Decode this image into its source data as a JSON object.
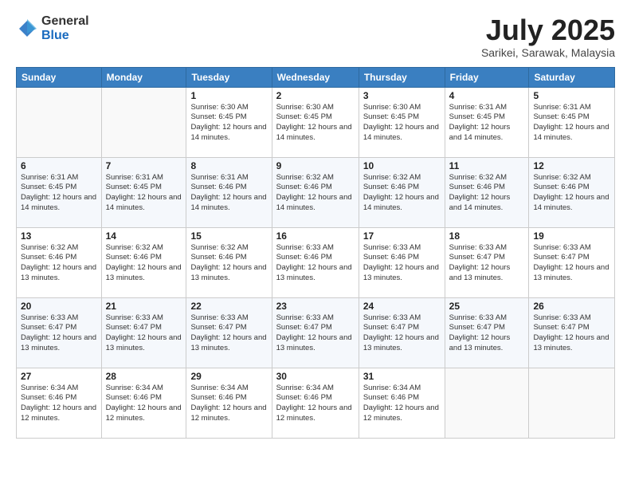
{
  "header": {
    "logo_general": "General",
    "logo_blue": "Blue",
    "month_title": "July 2025",
    "subtitle": "Sarikei, Sarawak, Malaysia"
  },
  "days_of_week": [
    "Sunday",
    "Monday",
    "Tuesday",
    "Wednesday",
    "Thursday",
    "Friday",
    "Saturday"
  ],
  "weeks": [
    [
      {
        "day": "",
        "info": ""
      },
      {
        "day": "",
        "info": ""
      },
      {
        "day": "1",
        "info": "Sunrise: 6:30 AM\nSunset: 6:45 PM\nDaylight: 12 hours and 14 minutes."
      },
      {
        "day": "2",
        "info": "Sunrise: 6:30 AM\nSunset: 6:45 PM\nDaylight: 12 hours and 14 minutes."
      },
      {
        "day": "3",
        "info": "Sunrise: 6:30 AM\nSunset: 6:45 PM\nDaylight: 12 hours and 14 minutes."
      },
      {
        "day": "4",
        "info": "Sunrise: 6:31 AM\nSunset: 6:45 PM\nDaylight: 12 hours and 14 minutes."
      },
      {
        "day": "5",
        "info": "Sunrise: 6:31 AM\nSunset: 6:45 PM\nDaylight: 12 hours and 14 minutes."
      }
    ],
    [
      {
        "day": "6",
        "info": "Sunrise: 6:31 AM\nSunset: 6:45 PM\nDaylight: 12 hours and 14 minutes."
      },
      {
        "day": "7",
        "info": "Sunrise: 6:31 AM\nSunset: 6:45 PM\nDaylight: 12 hours and 14 minutes."
      },
      {
        "day": "8",
        "info": "Sunrise: 6:31 AM\nSunset: 6:46 PM\nDaylight: 12 hours and 14 minutes."
      },
      {
        "day": "9",
        "info": "Sunrise: 6:32 AM\nSunset: 6:46 PM\nDaylight: 12 hours and 14 minutes."
      },
      {
        "day": "10",
        "info": "Sunrise: 6:32 AM\nSunset: 6:46 PM\nDaylight: 12 hours and 14 minutes."
      },
      {
        "day": "11",
        "info": "Sunrise: 6:32 AM\nSunset: 6:46 PM\nDaylight: 12 hours and 14 minutes."
      },
      {
        "day": "12",
        "info": "Sunrise: 6:32 AM\nSunset: 6:46 PM\nDaylight: 12 hours and 14 minutes."
      }
    ],
    [
      {
        "day": "13",
        "info": "Sunrise: 6:32 AM\nSunset: 6:46 PM\nDaylight: 12 hours and 13 minutes."
      },
      {
        "day": "14",
        "info": "Sunrise: 6:32 AM\nSunset: 6:46 PM\nDaylight: 12 hours and 13 minutes."
      },
      {
        "day": "15",
        "info": "Sunrise: 6:32 AM\nSunset: 6:46 PM\nDaylight: 12 hours and 13 minutes."
      },
      {
        "day": "16",
        "info": "Sunrise: 6:33 AM\nSunset: 6:46 PM\nDaylight: 12 hours and 13 minutes."
      },
      {
        "day": "17",
        "info": "Sunrise: 6:33 AM\nSunset: 6:46 PM\nDaylight: 12 hours and 13 minutes."
      },
      {
        "day": "18",
        "info": "Sunrise: 6:33 AM\nSunset: 6:47 PM\nDaylight: 12 hours and 13 minutes."
      },
      {
        "day": "19",
        "info": "Sunrise: 6:33 AM\nSunset: 6:47 PM\nDaylight: 12 hours and 13 minutes."
      }
    ],
    [
      {
        "day": "20",
        "info": "Sunrise: 6:33 AM\nSunset: 6:47 PM\nDaylight: 12 hours and 13 minutes."
      },
      {
        "day": "21",
        "info": "Sunrise: 6:33 AM\nSunset: 6:47 PM\nDaylight: 12 hours and 13 minutes."
      },
      {
        "day": "22",
        "info": "Sunrise: 6:33 AM\nSunset: 6:47 PM\nDaylight: 12 hours and 13 minutes."
      },
      {
        "day": "23",
        "info": "Sunrise: 6:33 AM\nSunset: 6:47 PM\nDaylight: 12 hours and 13 minutes."
      },
      {
        "day": "24",
        "info": "Sunrise: 6:33 AM\nSunset: 6:47 PM\nDaylight: 12 hours and 13 minutes."
      },
      {
        "day": "25",
        "info": "Sunrise: 6:33 AM\nSunset: 6:47 PM\nDaylight: 12 hours and 13 minutes."
      },
      {
        "day": "26",
        "info": "Sunrise: 6:33 AM\nSunset: 6:47 PM\nDaylight: 12 hours and 13 minutes."
      }
    ],
    [
      {
        "day": "27",
        "info": "Sunrise: 6:34 AM\nSunset: 6:46 PM\nDaylight: 12 hours and 12 minutes."
      },
      {
        "day": "28",
        "info": "Sunrise: 6:34 AM\nSunset: 6:46 PM\nDaylight: 12 hours and 12 minutes."
      },
      {
        "day": "29",
        "info": "Sunrise: 6:34 AM\nSunset: 6:46 PM\nDaylight: 12 hours and 12 minutes."
      },
      {
        "day": "30",
        "info": "Sunrise: 6:34 AM\nSunset: 6:46 PM\nDaylight: 12 hours and 12 minutes."
      },
      {
        "day": "31",
        "info": "Sunrise: 6:34 AM\nSunset: 6:46 PM\nDaylight: 12 hours and 12 minutes."
      },
      {
        "day": "",
        "info": ""
      },
      {
        "day": "",
        "info": ""
      }
    ]
  ]
}
